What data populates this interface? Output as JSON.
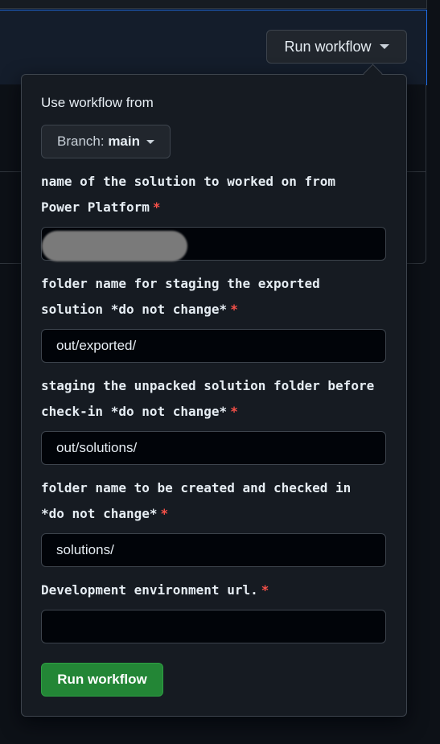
{
  "header": {
    "run_button_label": "Run workflow"
  },
  "dispatch_form": {
    "use_from_label": "Use workflow from",
    "branch": {
      "prefix": "Branch:",
      "name": "main"
    },
    "required_marker": "*",
    "fields": [
      {
        "label_line1": "name of the solution to worked on from",
        "label_line2": "Power Platform",
        "value": ""
      },
      {
        "label_line1": "folder name for staging the exported",
        "label_line2": "solution *do not change*",
        "value": "out/exported/"
      },
      {
        "label_line1": "staging the unpacked solution folder before",
        "label_line2": "check-in *do not change*",
        "value": "out/solutions/"
      },
      {
        "label_line1": "folder name to be created and checked in",
        "label_line2": "*do not change*",
        "value": "solutions/"
      },
      {
        "label_line1": "Development environment url.",
        "value": ""
      }
    ],
    "submit_label": "Run workflow"
  },
  "colors": {
    "background": "#0d1117",
    "panel": "#161b22",
    "border": "#3d444d",
    "accent_blue": "#1f6feb",
    "required": "#f85149",
    "primary_button": "#238636"
  }
}
